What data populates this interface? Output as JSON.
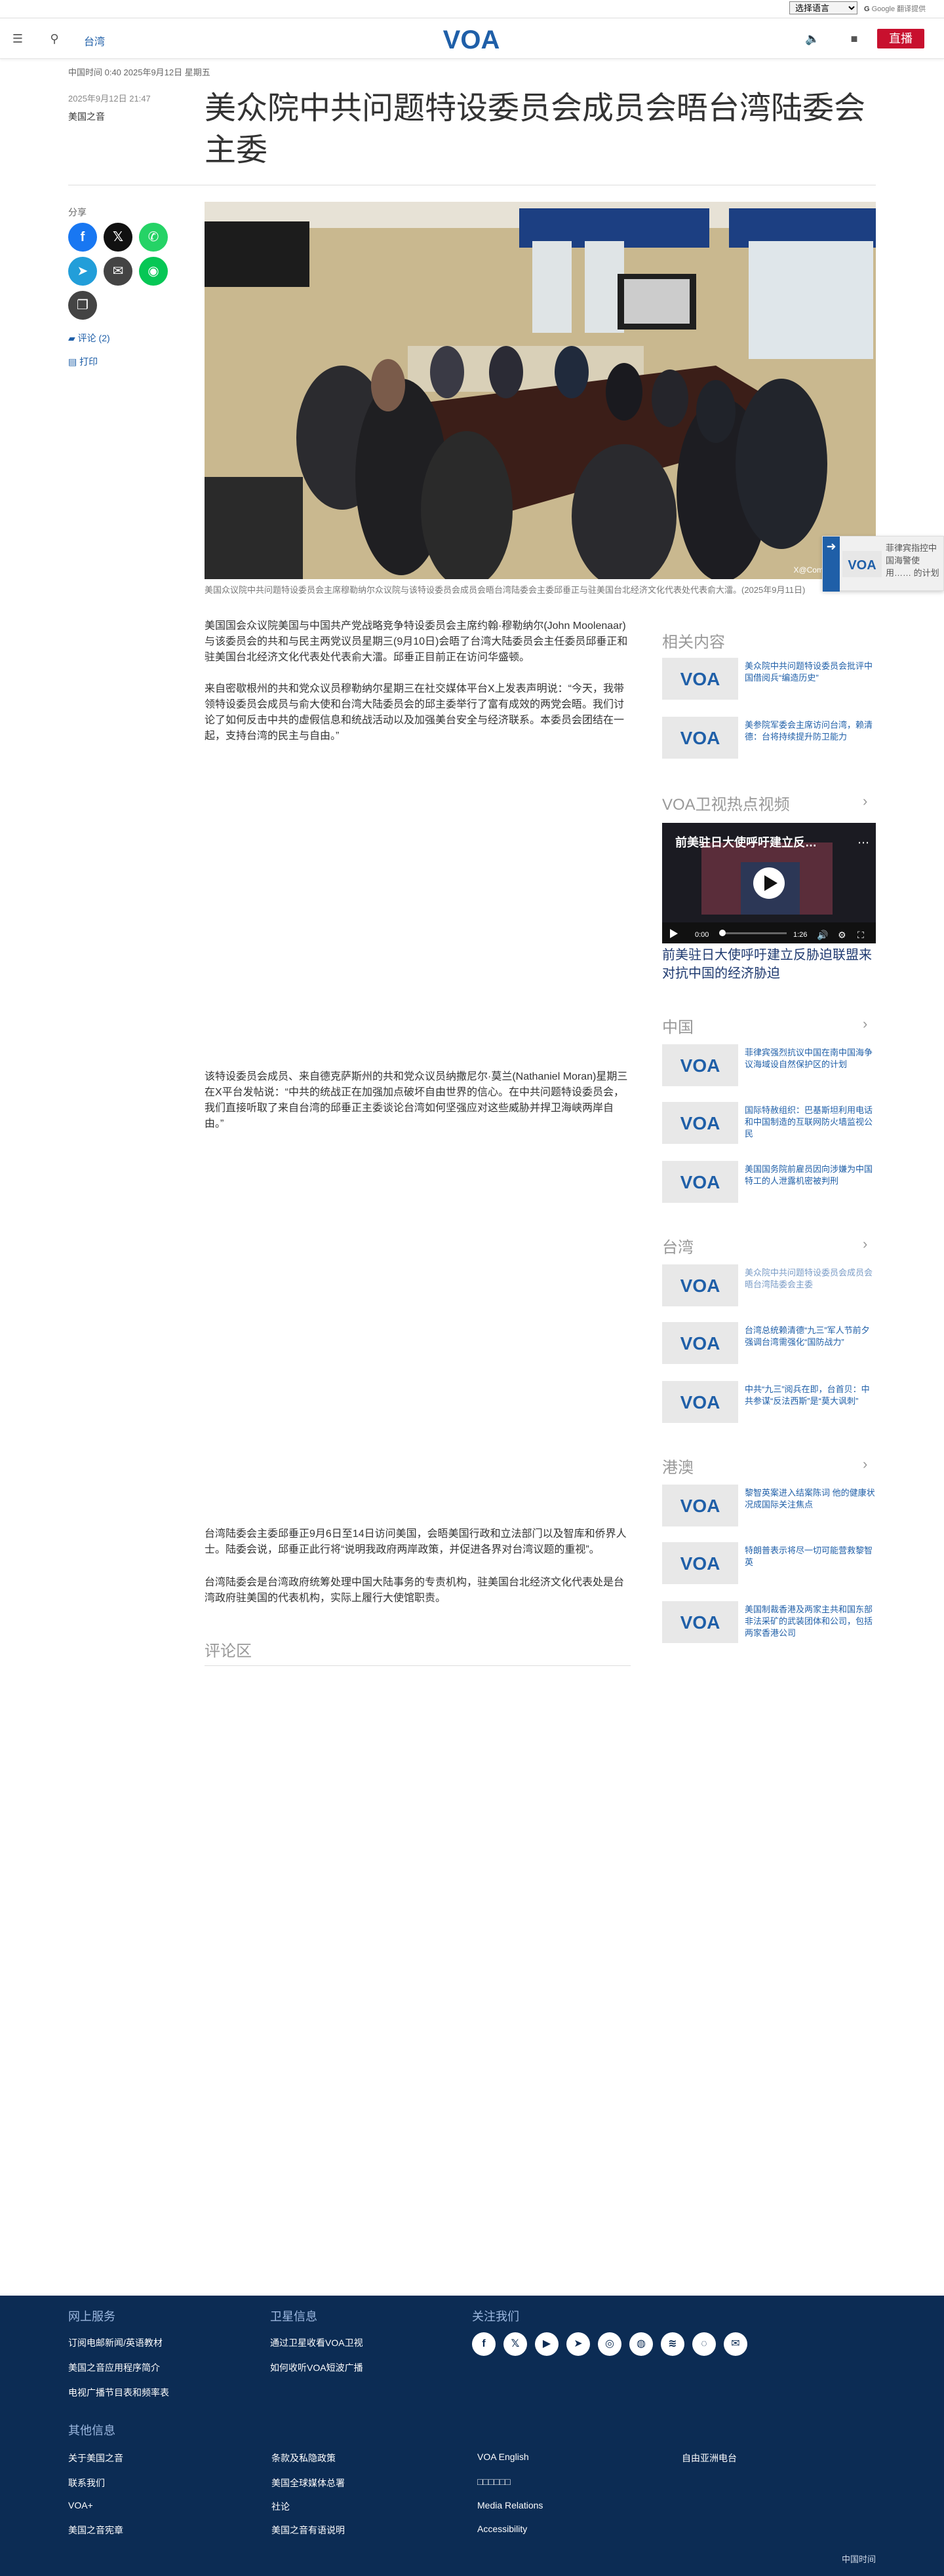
{
  "utility": {
    "language_select": "选择语言",
    "gt_text": "Google 翻译提供"
  },
  "header": {
    "section": "台湾",
    "live_label": "直播",
    "logo_text": "VOA"
  },
  "article": {
    "dateline": "中国时间 0:40 2025年9月12日 星期五",
    "published": "2025年9月12日 21:47",
    "author": "美国之音",
    "title": "美众院中共问题特设委员会成员会晤台湾陆委会主委",
    "share_label": "分享",
    "comments_link": "评论 (2)",
    "print_link": "打印",
    "photo_caption": "美国众议院中共问题特设委员会主席穆勒纳尔众议院与该特设委员会成员会晤台湾陆委会主委邱垂正与驻美国台北经济文化代表处代表俞大㵢。(2025年9月11日)",
    "photo_credit": "X@CommitteeOnCCP",
    "paragraphs": [
      "美国国会众议院美国与中国共产党战略竞争特设委员会主席约翰·穆勒纳尔(John Moolenaar)与该委员会的共和与民主两党议员星期三(9月10日)会晤了台湾大陆委员会主任委员邱垂正和驻美国台北经济文化代表处代表俞大㵢。邱垂正目前正在访问华盛顿。",
      "来自密歇根州的共和党众议员穆勒纳尔星期三在社交媒体平台X上发表声明说：“今天，我带领特设委员会成员与俞大使和台湾大陆委员会的邱主委举行了富有成效的两党会晤。我们讨论了如何反击中共的虚假信息和统战活动以及加强美台安全与经济联系。本委员会团结在一起，支持台湾的民主与自由。”",
      "该特设委员会成员、来自德克萨斯州的共和党众议员纳撒尼尔·莫兰(Nathaniel Moran)星期三在X平台发帖说：“中共的统战正在加强加点破坏自由世界的信心。在中共问题特设委员会，我们直接听取了来自台湾的邱垂正主委谈论台湾如何坚强应对这些威胁并捍卫海峡两岸自由。”",
      "台湾陆委会主委邱垂正9月6日至14日访问美国，会晤美国行政和立法部门以及智库和侨界人士。陆委会说，邱垂正此行将“说明我政府两岸政策，并促进各界对台湾议题的重视”。",
      "台湾陆委会是台湾政府统筹处理中国大陆事务的专责机构，驻美国台北经济文化代表处是台湾政府驻美国的代表机构，实际上履行大使馆职责。"
    ],
    "comments_title": "评论区"
  },
  "next_article": {
    "text": "菲律宾指控中国海警使用…… 的计划"
  },
  "sidebar": {
    "related": {
      "title": "相关内容",
      "items": [
        "美众院中共问题特设委员会批评中国借阅兵“编造历史”",
        "美参院军委会主席访问台湾，赖清德：台将持续提升防卫能力"
      ]
    },
    "video": {
      "title": "VOA卫视热点视频",
      "clip_title": "前美驻日大使呼吁建立反…",
      "time": "0:00",
      "duration": "1:26",
      "caption": "前美驻日大使呼吁建立反胁迫联盟来对抗中国的经济胁迫"
    },
    "china": {
      "title": "中国",
      "items": [
        "菲律宾强烈抗议中国在南中国海争议海域设自然保护区的计划",
        "国际特赦组织：巴基斯坦利用电话和中国制造的互联网防火墙监视公民",
        "美国国务院前雇员因向涉嫌为中国特工的人泄露机密被判刑"
      ]
    },
    "taiwan": {
      "title": "台湾",
      "items": [
        "美众院中共问题特设委员会成员会晤台湾陆委会主委",
        "台湾总统赖清德“九三”军人节前夕强调台湾需强化“国防战力”",
        "中共“九三”阅兵在即，台首贝：中共参谋“反法西斯”是“莫大讽刺”"
      ]
    },
    "hongkong": {
      "title": "港澳",
      "items": [
        "黎智英案进入结案陈词 他的健康状况成国际关注焦点",
        "特朗普表示将尽一切可能营救黎智英",
        "美国制裁香港及两家主共和国东部非法采矿的武装团体和公司，包括两家香港公司"
      ]
    }
  },
  "footer": {
    "online": {
      "title": "网上服务",
      "links": [
        "订阅电邮新闻/英语教材",
        "美国之音应用程序简介",
        "电视广播节目表和频率表"
      ]
    },
    "satellite": {
      "title": "卫星信息",
      "links": [
        "通过卫星收看VOA卫视",
        "如何收听VOA短波广播"
      ]
    },
    "follow": {
      "title": "关注我们"
    },
    "other": {
      "title": "其他信息",
      "links": [
        "关于美国之音",
        "联系我们",
        "VOA+",
        "美国之音宪章",
        "条款及私隐政策",
        "美国全球媒体总署",
        "社论",
        "美国之音有语说明",
        "VOA English",
        "□□□□□□",
        "Media Relations",
        "Accessibility",
        "自由亚洲电台"
      ]
    },
    "copyright": "中国时间"
  },
  "colors": {
    "brand_blue": "#1f5fa8",
    "live_red": "#c8102e",
    "footer_bg": "#0c2c54"
  }
}
